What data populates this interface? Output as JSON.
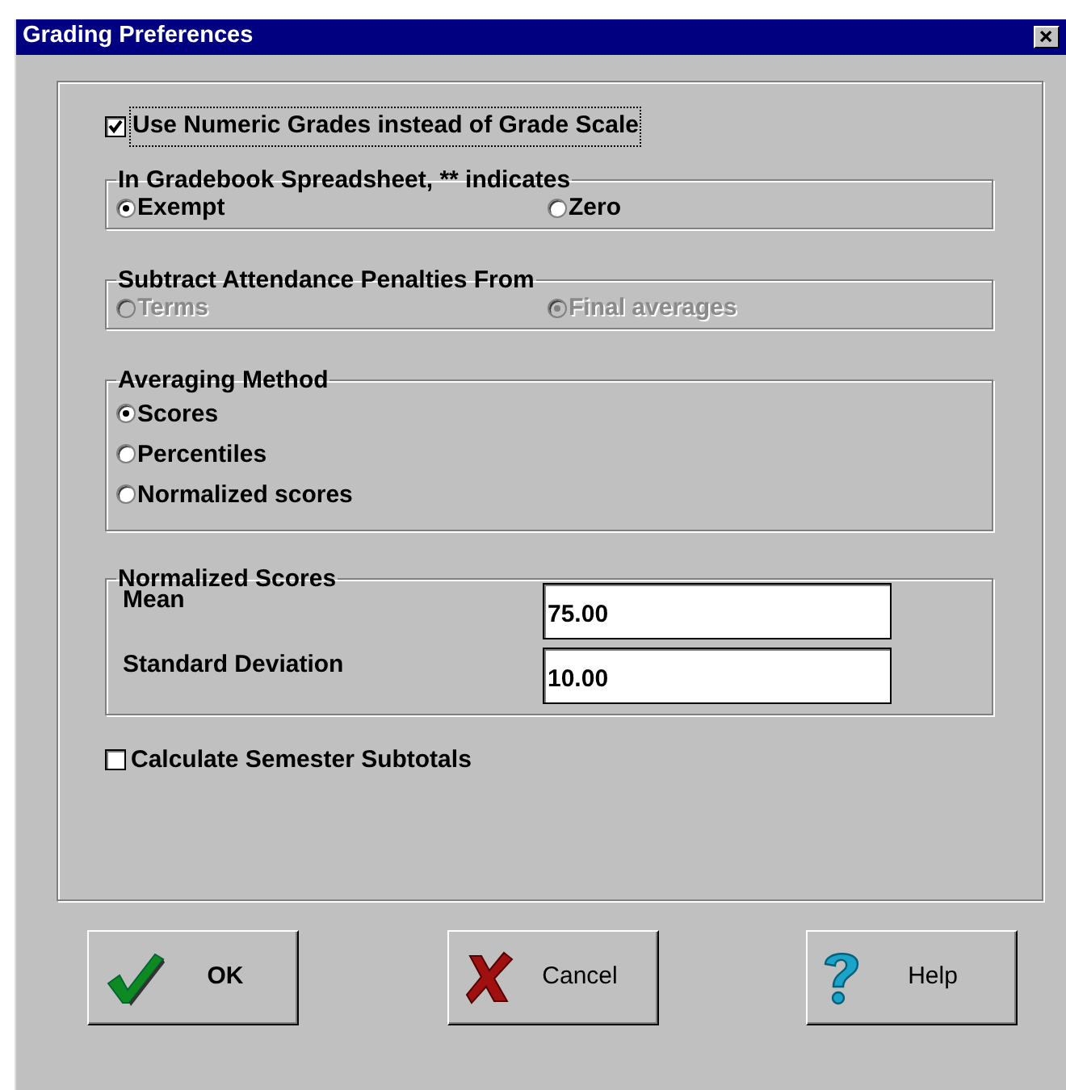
{
  "window": {
    "title": "Grading Preferences"
  },
  "numeric_grades": {
    "label": "Use Numeric Grades instead of Grade Scale",
    "checked": true,
    "focused": true
  },
  "groups": [
    {
      "title": "In Gradebook Spreadsheet, ** indicates",
      "disabled": false,
      "kind": "inline",
      "options": [
        {
          "label": "Exempt",
          "selected": true
        },
        {
          "label": "Zero",
          "selected": false
        }
      ]
    },
    {
      "title": "Subtract Attendance Penalties From",
      "disabled": true,
      "kind": "inline",
      "options": [
        {
          "label": "Terms",
          "selected": false
        },
        {
          "label": "Final averages",
          "selected": true
        }
      ]
    },
    {
      "title": "Averaging Method",
      "disabled": false,
      "kind": "stacked",
      "options": [
        {
          "label": "Scores",
          "selected": true
        },
        {
          "label": "Percentiles",
          "selected": false
        },
        {
          "label": "Normalized scores",
          "selected": false
        }
      ]
    }
  ],
  "normalized_scores": {
    "title": "Normalized Scores",
    "fields": [
      {
        "label": "Mean",
        "value": "75.00"
      },
      {
        "label": "Standard Deviation",
        "value": "10.00"
      }
    ]
  },
  "semester_subtotals": {
    "label": "Calculate Semester Subtotals",
    "checked": false,
    "focused": false
  },
  "buttons": [
    {
      "kind": "ok",
      "label": "OK"
    },
    {
      "kind": "cancel",
      "label": "Cancel"
    },
    {
      "kind": "help",
      "label": "Help"
    }
  ]
}
